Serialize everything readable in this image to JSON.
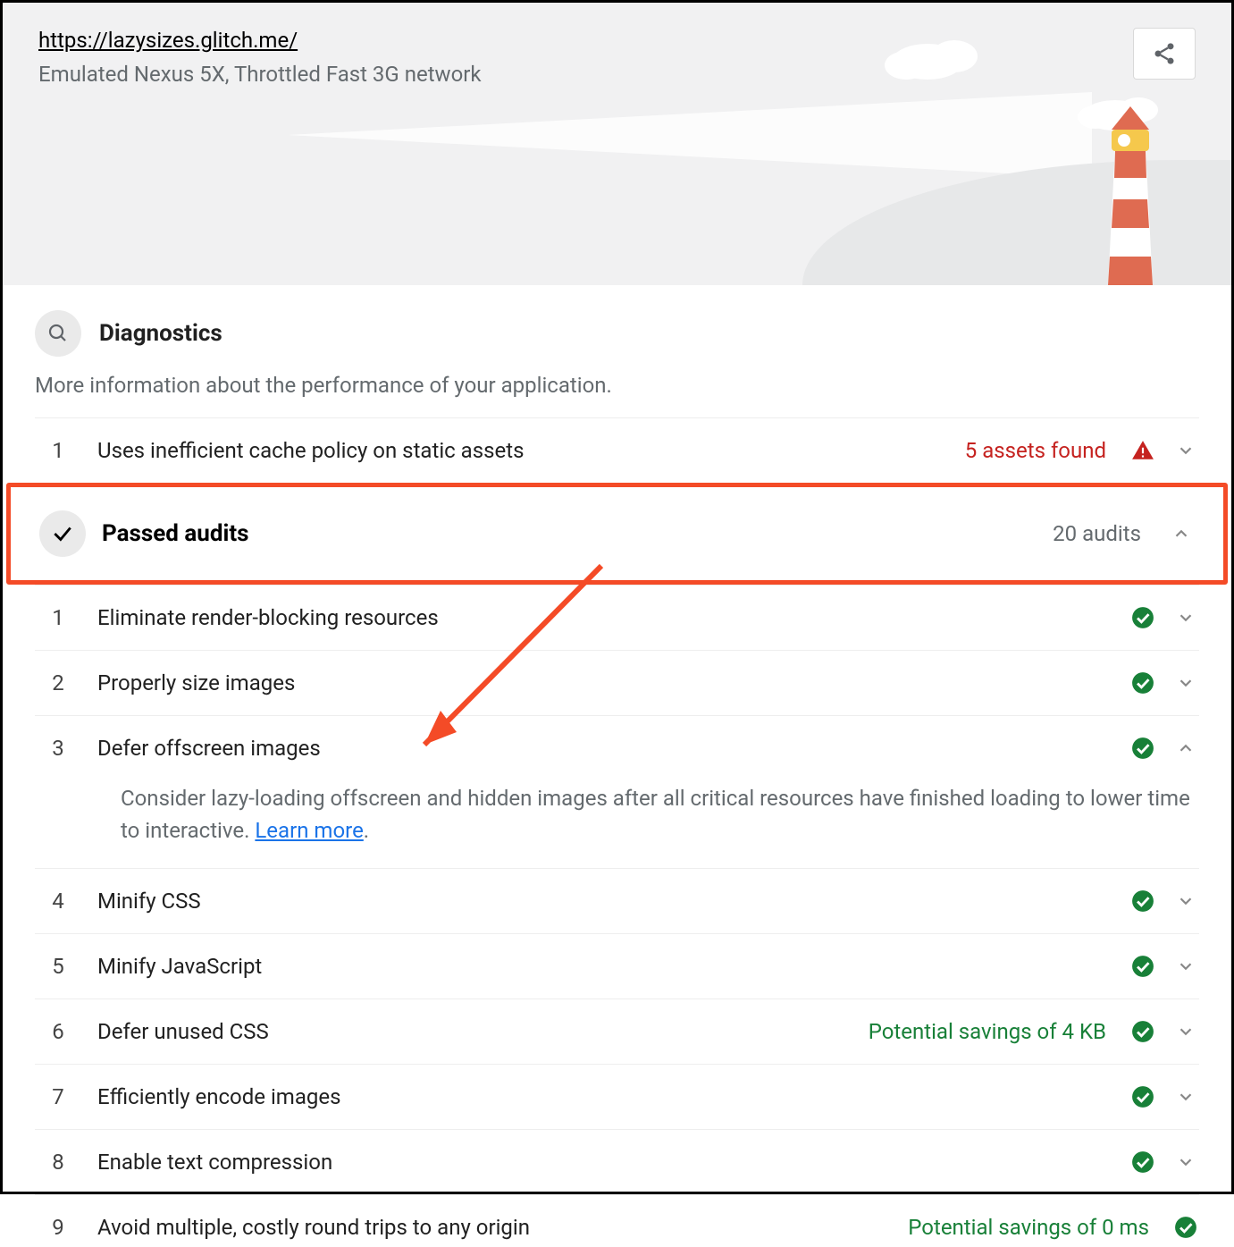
{
  "header": {
    "url": "https://lazysizes.glitch.me/",
    "subtitle": "Emulated Nexus 5X, Throttled Fast 3G network"
  },
  "diagnostics": {
    "title": "Diagnostics",
    "description": "More information about the performance of your application.",
    "items": [
      {
        "n": "1",
        "label": "Uses inefficient cache policy on static assets",
        "summary": "5 assets found"
      }
    ]
  },
  "passed": {
    "title": "Passed audits",
    "count": "20 audits",
    "items": [
      {
        "n": "1",
        "label": "Eliminate render-blocking resources",
        "expanded": false
      },
      {
        "n": "2",
        "label": "Properly size images",
        "expanded": false
      },
      {
        "n": "3",
        "label": "Defer offscreen images",
        "expanded": true,
        "detail": "Consider lazy-loading offscreen and hidden images after all critical resources have finished loading to lower time to interactive. ",
        "learn": "Learn more"
      },
      {
        "n": "4",
        "label": "Minify CSS",
        "expanded": false
      },
      {
        "n": "5",
        "label": "Minify JavaScript",
        "expanded": false
      },
      {
        "n": "6",
        "label": "Defer unused CSS",
        "summary": "Potential savings of 4 KB",
        "expanded": false
      },
      {
        "n": "7",
        "label": "Efficiently encode images",
        "expanded": false
      },
      {
        "n": "8",
        "label": "Enable text compression",
        "expanded": false
      },
      {
        "n": "9",
        "label": "Avoid multiple, costly round trips to any origin",
        "summary": "Potential savings of 0 ms",
        "expanded": false
      }
    ]
  }
}
